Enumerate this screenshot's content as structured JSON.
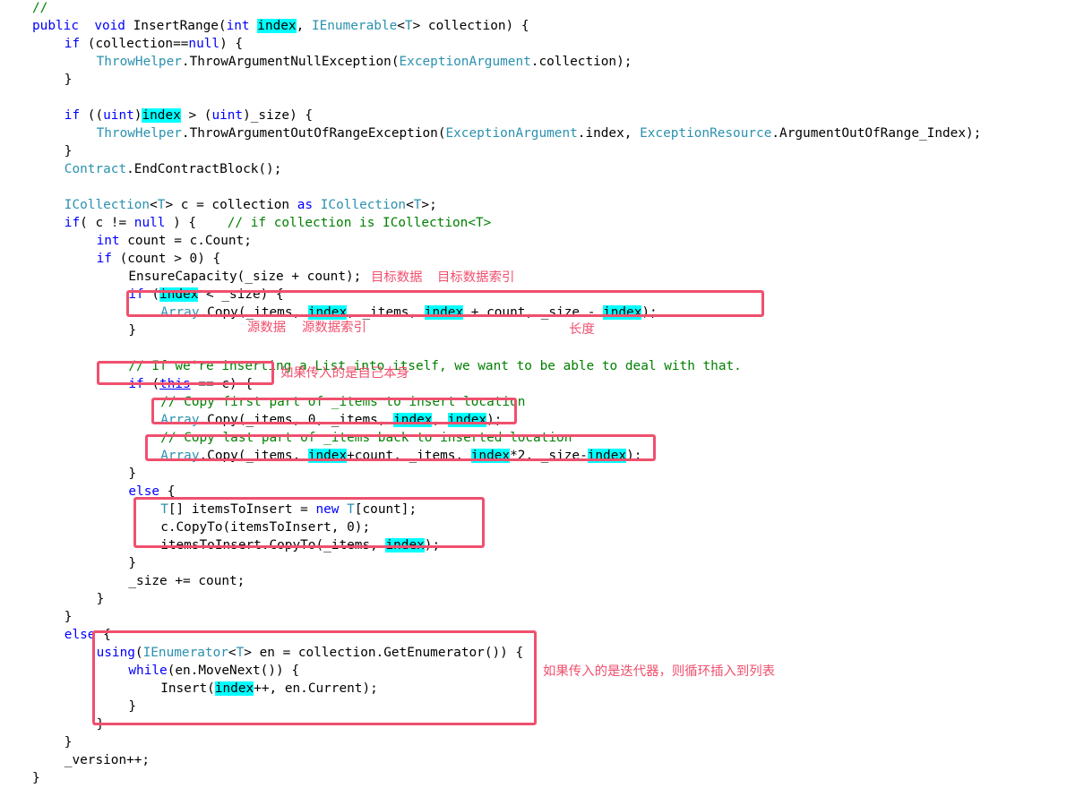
{
  "colors": {
    "keyword": "#0000ff",
    "type": "#2b91af",
    "comment": "#008000",
    "highlight": "#00ffff",
    "annotation": "#f0506e"
  },
  "code_lines": [
    {
      "indent": 0,
      "tokens": [
        [
          "cm",
          "//"
        ]
      ]
    },
    {
      "indent": 0,
      "tokens": [
        [
          "kw",
          "public"
        ],
        [
          "",
          "  "
        ],
        [
          "kw",
          "void"
        ],
        [
          "",
          " InsertRange("
        ],
        [
          "kw",
          "int"
        ],
        [
          "",
          " "
        ],
        [
          "hl",
          "index"
        ],
        [
          "",
          ", "
        ],
        [
          "ty",
          "IEnumerable"
        ],
        [
          "",
          "<"
        ],
        [
          "ty",
          "T"
        ],
        [
          "",
          "> collection) {"
        ]
      ]
    },
    {
      "indent": 1,
      "tokens": [
        [
          "kw",
          "if"
        ],
        [
          "",
          " (collection=="
        ],
        [
          "kw",
          "null"
        ],
        [
          "",
          ") {"
        ]
      ]
    },
    {
      "indent": 2,
      "tokens": [
        [
          "ty",
          "ThrowHelper"
        ],
        [
          "",
          ".ThrowArgumentNullException("
        ],
        [
          "ty",
          "ExceptionArgument"
        ],
        [
          "",
          ".collection);"
        ]
      ]
    },
    {
      "indent": 1,
      "tokens": [
        [
          "",
          "}"
        ]
      ]
    },
    {
      "indent": 0,
      "tokens": []
    },
    {
      "indent": 1,
      "tokens": [
        [
          "kw",
          "if"
        ],
        [
          "",
          " (("
        ],
        [
          "kw",
          "uint"
        ],
        [
          "",
          ")"
        ],
        [
          "hl",
          "index"
        ],
        [
          "",
          " > ("
        ],
        [
          "kw",
          "uint"
        ],
        [
          "",
          ")_size) {"
        ]
      ]
    },
    {
      "indent": 2,
      "tokens": [
        [
          "ty",
          "ThrowHelper"
        ],
        [
          "",
          ".ThrowArgumentOutOfRangeException("
        ],
        [
          "ty",
          "ExceptionArgument"
        ],
        [
          "",
          ".index, "
        ],
        [
          "ty",
          "ExceptionResource"
        ],
        [
          "",
          ".ArgumentOutOfRange_Index);"
        ]
      ]
    },
    {
      "indent": 1,
      "tokens": [
        [
          "",
          "}"
        ]
      ]
    },
    {
      "indent": 1,
      "tokens": [
        [
          "ty",
          "Contract"
        ],
        [
          "",
          ".EndContractBlock();"
        ]
      ]
    },
    {
      "indent": 0,
      "tokens": []
    },
    {
      "indent": 1,
      "tokens": [
        [
          "ty",
          "ICollection"
        ],
        [
          "",
          "<"
        ],
        [
          "ty",
          "T"
        ],
        [
          "",
          "> c = collection "
        ],
        [
          "kw",
          "as"
        ],
        [
          "",
          " "
        ],
        [
          "ty",
          "ICollection"
        ],
        [
          "",
          "<"
        ],
        [
          "ty",
          "T"
        ],
        [
          "",
          ">;"
        ]
      ]
    },
    {
      "indent": 1,
      "tokens": [
        [
          "kw",
          "if"
        ],
        [
          "",
          "( c != "
        ],
        [
          "kw",
          "null"
        ],
        [
          "",
          " ) {    "
        ],
        [
          "cm",
          "// if collection is ICollection<T>"
        ]
      ]
    },
    {
      "indent": 2,
      "tokens": [
        [
          "kw",
          "int"
        ],
        [
          "",
          " count = c.Count;"
        ]
      ]
    },
    {
      "indent": 2,
      "tokens": [
        [
          "kw",
          "if"
        ],
        [
          "",
          " (count > 0) {"
        ]
      ]
    },
    {
      "indent": 3,
      "tokens": [
        [
          "",
          "EnsureCapacity(_size + count);"
        ]
      ]
    },
    {
      "indent": 3,
      "tokens": [
        [
          "kw",
          "if"
        ],
        [
          "",
          " ("
        ],
        [
          "hl",
          "index"
        ],
        [
          "",
          " < _size) {"
        ]
      ]
    },
    {
      "indent": 4,
      "tokens": [
        [
          "ty",
          "Array"
        ],
        [
          "",
          ".Copy(_items, "
        ],
        [
          "hl",
          "index"
        ],
        [
          "",
          ", _items, "
        ],
        [
          "hl",
          "index"
        ],
        [
          "",
          " + count, _size - "
        ],
        [
          "hl",
          "index"
        ],
        [
          "",
          ");"
        ]
      ]
    },
    {
      "indent": 3,
      "tokens": [
        [
          "",
          "}"
        ]
      ]
    },
    {
      "indent": 0,
      "tokens": []
    },
    {
      "indent": 3,
      "tokens": [
        [
          "cm",
          "// If we're inserting a List into itself, we want to be able to deal with that."
        ]
      ]
    },
    {
      "indent": 3,
      "tokens": [
        [
          "kw",
          "if"
        ],
        [
          "",
          " ("
        ],
        [
          "kwu",
          "this"
        ],
        [
          "",
          " == c) {"
        ]
      ]
    },
    {
      "indent": 4,
      "tokens": [
        [
          "cm",
          "// Copy first part of _items to insert location"
        ]
      ]
    },
    {
      "indent": 4,
      "tokens": [
        [
          "ty",
          "Array"
        ],
        [
          "",
          ".Copy(_items, 0, _items, "
        ],
        [
          "hl",
          "index"
        ],
        [
          "",
          ", "
        ],
        [
          "hl",
          "index"
        ],
        [
          "",
          ");"
        ]
      ]
    },
    {
      "indent": 4,
      "tokens": [
        [
          "cm",
          "// Copy last part of _items back to inserted location"
        ]
      ]
    },
    {
      "indent": 4,
      "tokens": [
        [
          "ty",
          "Array"
        ],
        [
          "",
          ".Copy(_items, "
        ],
        [
          "hl",
          "index"
        ],
        [
          "",
          "+count, _items, "
        ],
        [
          "hl",
          "index"
        ],
        [
          "",
          "*2, _size-"
        ],
        [
          "hl",
          "index"
        ],
        [
          "",
          ");"
        ]
      ]
    },
    {
      "indent": 3,
      "tokens": [
        [
          "",
          "}"
        ]
      ]
    },
    {
      "indent": 3,
      "tokens": [
        [
          "kw",
          "else"
        ],
        [
          "",
          " {"
        ]
      ]
    },
    {
      "indent": 4,
      "tokens": [
        [
          "ty",
          "T"
        ],
        [
          "",
          "[] itemsToInsert = "
        ],
        [
          "kw",
          "new"
        ],
        [
          "",
          " "
        ],
        [
          "ty",
          "T"
        ],
        [
          "",
          "[count];"
        ]
      ]
    },
    {
      "indent": 4,
      "tokens": [
        [
          "",
          "c.CopyTo(itemsToInsert, 0);"
        ]
      ]
    },
    {
      "indent": 4,
      "tokens": [
        [
          "",
          "itemsToInsert.CopyTo(_items, "
        ],
        [
          "hl",
          "index"
        ],
        [
          "",
          ");"
        ]
      ]
    },
    {
      "indent": 3,
      "tokens": [
        [
          "",
          "}"
        ]
      ]
    },
    {
      "indent": 3,
      "tokens": [
        [
          "",
          "_size += count;"
        ]
      ]
    },
    {
      "indent": 2,
      "tokens": [
        [
          "",
          "}"
        ]
      ]
    },
    {
      "indent": 1,
      "tokens": [
        [
          "",
          "}"
        ]
      ]
    },
    {
      "indent": 1,
      "tokens": [
        [
          "kw",
          "else"
        ],
        [
          "",
          " {"
        ]
      ]
    },
    {
      "indent": 2,
      "tokens": [
        [
          "kw",
          "using"
        ],
        [
          "",
          "("
        ],
        [
          "ty",
          "IEnumerator"
        ],
        [
          "",
          "<"
        ],
        [
          "ty",
          "T"
        ],
        [
          "",
          "> en = collection.GetEnumerator()) {"
        ]
      ]
    },
    {
      "indent": 3,
      "tokens": [
        [
          "kw",
          "while"
        ],
        [
          "",
          "(en.MoveNext()) {"
        ]
      ]
    },
    {
      "indent": 4,
      "tokens": [
        [
          "",
          "Insert("
        ],
        [
          "hl",
          "index"
        ],
        [
          "",
          "++, en.Current);"
        ]
      ]
    },
    {
      "indent": 3,
      "tokens": [
        [
          "",
          "}"
        ]
      ]
    },
    {
      "indent": 2,
      "tokens": [
        [
          "",
          "}"
        ]
      ]
    },
    {
      "indent": 1,
      "tokens": [
        [
          "",
          "}"
        ]
      ]
    },
    {
      "indent": 1,
      "tokens": [
        [
          "",
          "_version++;"
        ]
      ]
    },
    {
      "indent": 0,
      "tokens": [
        [
          "",
          "}"
        ]
      ]
    }
  ],
  "annotations": {
    "target_data": "目标数据",
    "target_index": "目标数据索引",
    "source_data": "源数据",
    "source_index": "源数据索引",
    "length": "长度",
    "self_insert": "如果传入的是自己本身",
    "enumerator": "如果传入的是迭代器，则循环插入到列表"
  }
}
